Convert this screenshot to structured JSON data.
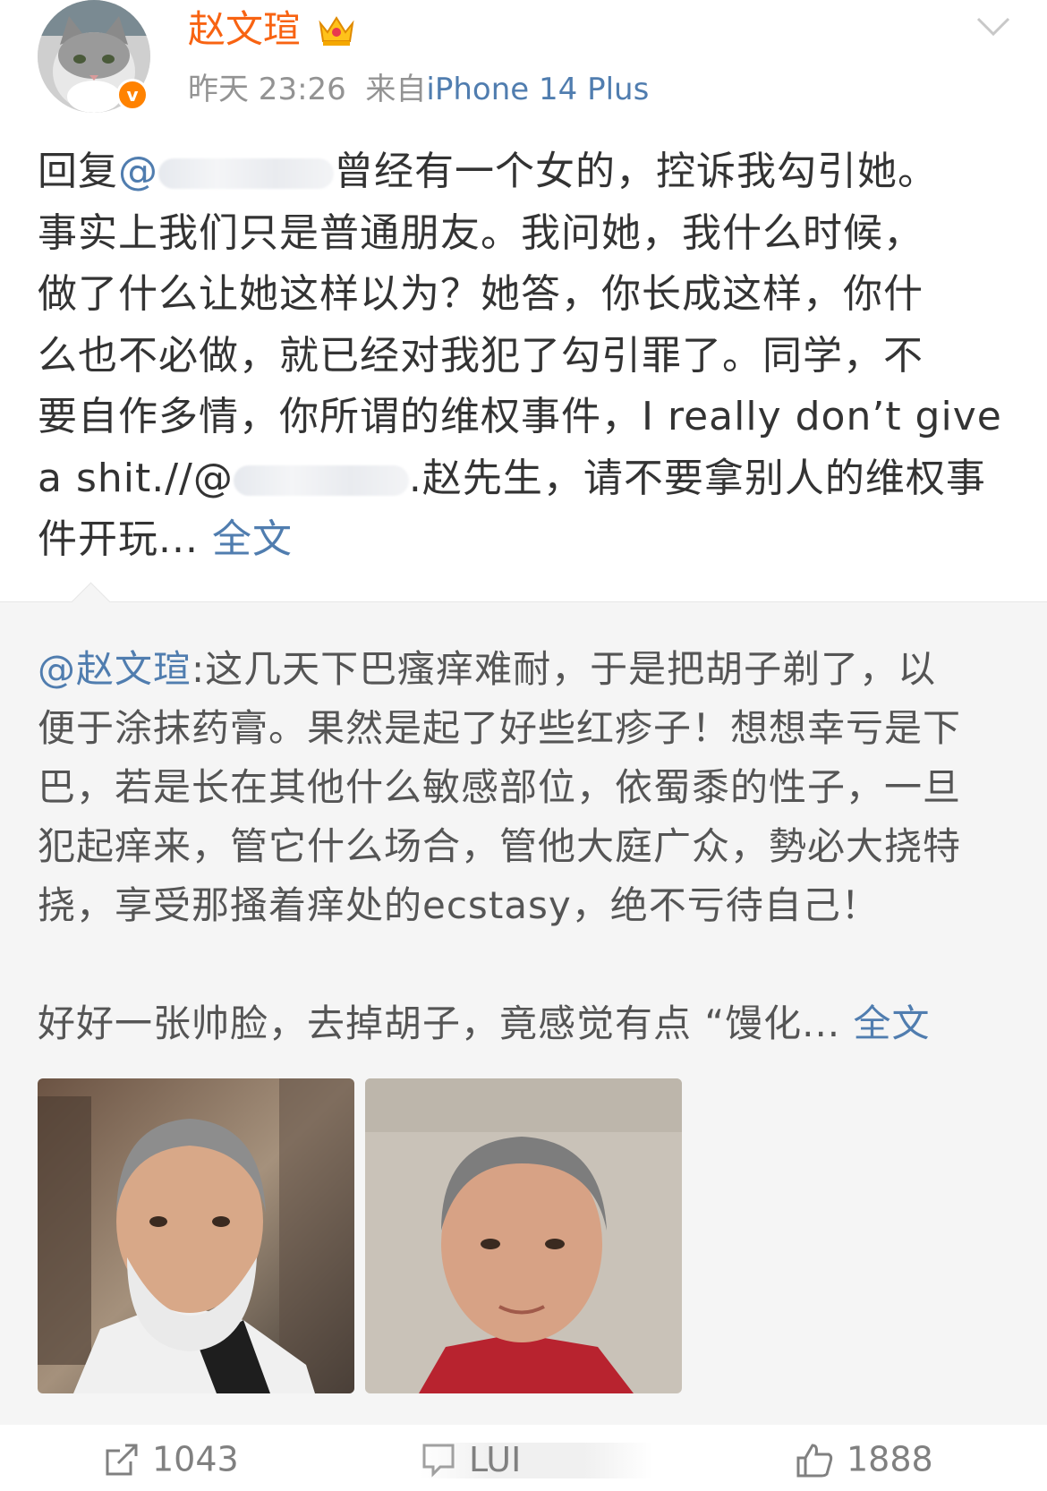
{
  "user": {
    "name": "赵文瑄",
    "time": "昨天 23:26",
    "source_prefix": "来自",
    "device": "iPhone 14 Plus",
    "verified_mark": "v"
  },
  "post": {
    "reply_prefix": "回复",
    "at_sign": "@",
    "line1_rest": "曾经有一个女的，控诉我勾引她。",
    "line2": "事实上我们只是普通朋友。我问她，我什么时候，",
    "line3": "做了什么让她这样以为？她答，你长成这样，你什",
    "line4": "么也不必做，就已经对我犯了勾引罪了。同学，不",
    "line5": "要自作多情，你所谓的维权事件，I really don’t give",
    "line6_start": "a shit.//@",
    "line6_rest": ".赵先生，请不要拿别人的维权事",
    "line7": "件开玩...",
    "full_text_link": "全文"
  },
  "repost": {
    "mention": "@赵文瑄",
    "text": ":这几天下巴瘙痒难耐，于是把胡子剃了，以便于涂抹药膏。果然是起了好些红疹子！想想幸亏是下巴，若是长在其他什么敏感部位，依蜀黍的性子，一旦犯起痒来，管它什么场合，管他大庭广众，勢必大挠特挠，享受那搔着痒处的ecstasy，绝不亏待自己！",
    "line_a_rest": ":这几天下巴瘙痒难耐，于是把胡子剃了，以",
    "line_b": "便于涂抹药膏。果然是起了好些红疹子！想想幸亏是下",
    "line_c": "巴，若是长在其他什么敏感部位，依蜀黍的性子，一旦",
    "line_d": "犯起痒来，管它什么场合，管他大庭广众，勢必大挠特",
    "line_e": "挠，享受那搔着痒处的ecstasy，绝不亏待自己！",
    "second_para": "好好一张帅脸，去掉胡子，竟感觉有点 “馒化...",
    "full_text_link": "全文"
  },
  "actions": {
    "share_count": "1043",
    "comment_count": "LUI",
    "like_count": "1888"
  },
  "colors": {
    "username": "#f86312",
    "link": "#507daf",
    "meta": "#939393",
    "repost_bg": "#f5f5f5"
  },
  "icons": [
    "avatar-cat-photo",
    "vip-crown-icon",
    "verified-badge-icon",
    "chevron-down-icon",
    "share-icon",
    "comment-icon",
    "like-icon"
  ]
}
